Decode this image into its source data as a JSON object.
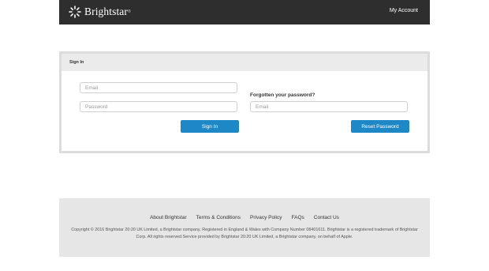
{
  "header": {
    "brand": "Brightstar",
    "trademark": "®",
    "my_account": "My Account"
  },
  "signin": {
    "title": "Sign In",
    "email_placeholder": "Email",
    "password_placeholder": "Password",
    "button_label": "Sign In"
  },
  "forgot": {
    "heading": "Forgotten your password?",
    "email_placeholder": "Email",
    "button_label": "Reset Password"
  },
  "footer": {
    "links": [
      "About Brightstar",
      "Terms & Conditions",
      "Privacy Policy",
      "FAQs",
      "Contact Us"
    ],
    "copyright": "Copyright © 2016 Brightstar 20:20 UK Limited, a Brightstar company. Registered in England & Wales with Company Number 08401611. Brightstar is a registered trademark of Brightstar Corp. All rights reserved.Service provided by Brightstar 20:20 UK Limited, a Brightstar company, on behalf of Apple."
  },
  "colors": {
    "topbar": "#2e2e2e",
    "button": "#1e88c7",
    "panel_border": "#dcdcdc",
    "footer_bg": "#e6e6e6"
  },
  "icons": {
    "logo": "brightstar-burst-icon"
  }
}
